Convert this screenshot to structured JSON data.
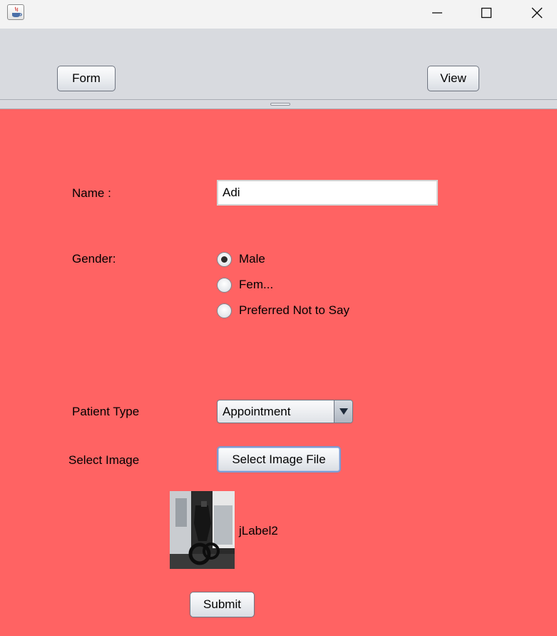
{
  "window": {
    "icons": {
      "app": "java-cup-icon",
      "minimize": "minimize-icon",
      "maximize": "maximize-icon",
      "close": "close-icon"
    }
  },
  "toolbar": {
    "form_label": "Form",
    "view_label": "View"
  },
  "form": {
    "name_label": "Name :",
    "name_value": "Adi",
    "gender_label": "Gender:",
    "gender_options": [
      {
        "label": "Male",
        "selected": true
      },
      {
        "label": "Fem...",
        "selected": false
      },
      {
        "label": "Preferred Not to Say",
        "selected": false
      }
    ],
    "patient_type_label": "Patient Type",
    "patient_type_value": "Appointment",
    "select_image_label": "Select Image",
    "select_image_button": "Select Image File",
    "image_caption": "jLabel2",
    "submit_label": "Submit"
  },
  "colors": {
    "panel_background": "#ff6363",
    "toolbar_background": "#d8dadf",
    "titlebar_background": "#f3f3f3"
  }
}
